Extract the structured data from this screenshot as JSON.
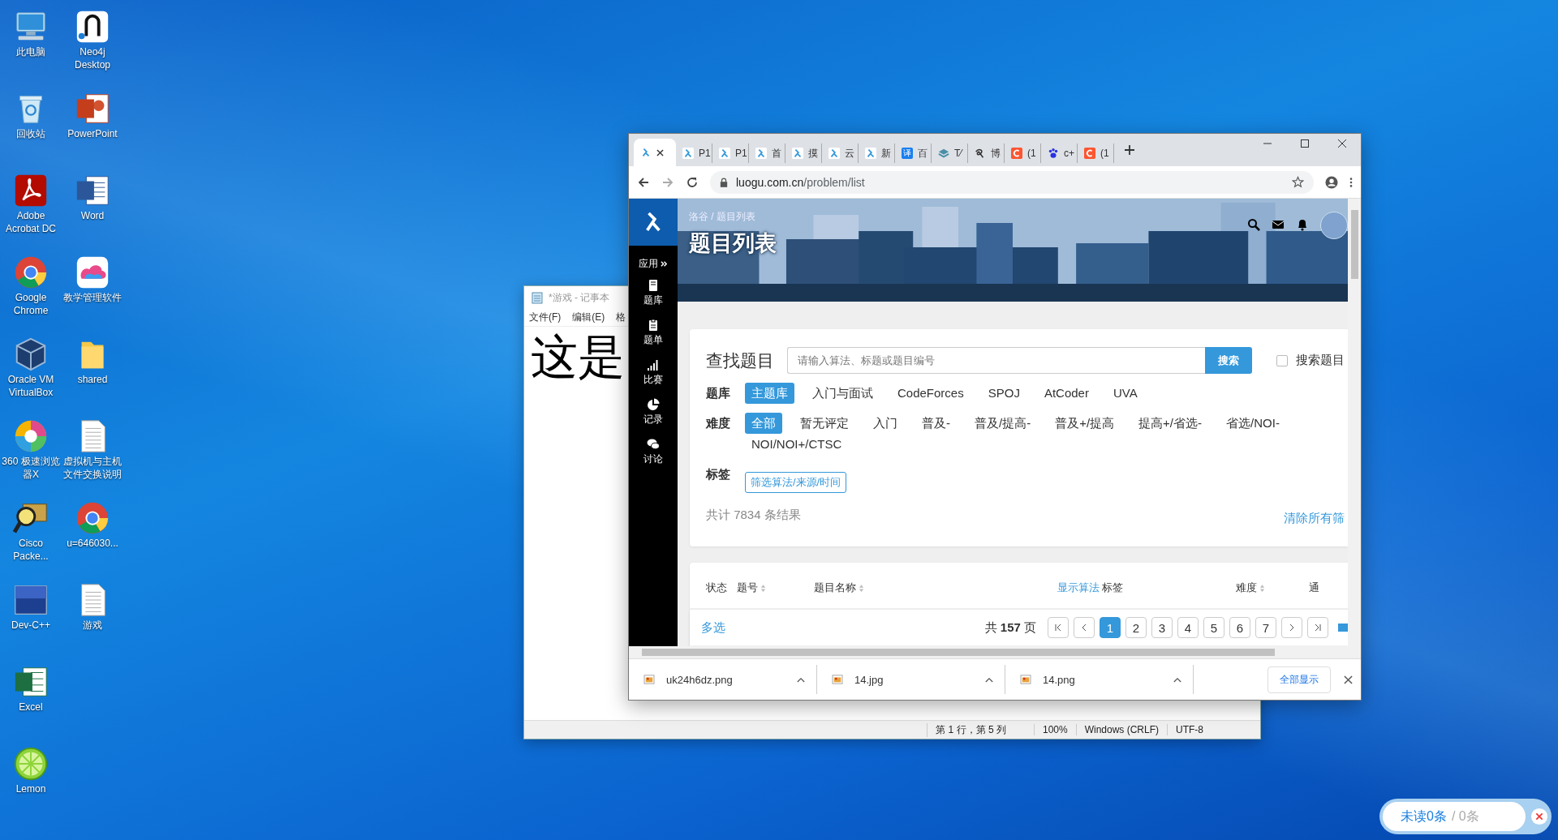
{
  "desktop_icons": [
    {
      "label": "此电脑",
      "kind": "monitor"
    },
    {
      "label": "回收站",
      "kind": "bin"
    },
    {
      "label": "Adobe Acrobat DC",
      "kind": "pdf"
    },
    {
      "label": "Google Chrome",
      "kind": "globe"
    },
    {
      "label": "Oracle VM VirtualBox",
      "kind": "cube"
    },
    {
      "label": "360 极速浏览器X",
      "kind": "swirl"
    },
    {
      "label": "Cisco Packe...",
      "kind": "magnifier"
    },
    {
      "label": "Dev-C++",
      "kind": "dev"
    },
    {
      "label": "Excel",
      "kind": "sheet"
    },
    {
      "label": "Lemon",
      "kind": "lime"
    },
    {
      "label": "Neo4j Desktop",
      "kind": "graph"
    },
    {
      "label": "PowerPoint",
      "kind": "slides"
    },
    {
      "label": "Word",
      "kind": "doc"
    },
    {
      "label": "教学管理软件",
      "kind": "cloud"
    },
    {
      "label": "shared",
      "kind": "folder"
    },
    {
      "label": "虚拟机与主机文件交换说明",
      "kind": "textfile"
    },
    {
      "label": "u=646030...",
      "kind": "globe"
    },
    {
      "label": "游戏",
      "kind": "textfile"
    }
  ],
  "notepad": {
    "title": "*游戏 - 记事本",
    "menu": [
      "文件(F)",
      "编辑(E)",
      "格"
    ],
    "text": "这是",
    "status": [
      "第 1 行，第 5 列",
      "100%",
      "Windows (CRLF)",
      "UTF-8"
    ]
  },
  "browser": {
    "tabs": [
      {
        "selected": true,
        "kind": "bird"
      },
      {
        "label": "P1",
        "selected": false,
        "kind": "bird"
      },
      {
        "label": "P1",
        "selected": false,
        "kind": "bird"
      },
      {
        "label": "首",
        "selected": false,
        "kind": "bird"
      },
      {
        "label": "摸",
        "selected": false,
        "kind": "bird"
      },
      {
        "label": "云",
        "selected": false,
        "kind": "bird"
      },
      {
        "label": "新",
        "selected": false,
        "kind": "bird"
      },
      {
        "label": "百",
        "selected": false,
        "kind": "badge"
      },
      {
        "label": "T⁄",
        "selected": false,
        "kind": "stack"
      },
      {
        "label": "博",
        "selected": false,
        "kind": "loop"
      },
      {
        "label": "(1",
        "selected": false,
        "kind": "square"
      },
      {
        "label": "c+",
        "selected": false,
        "kind": "paw"
      },
      {
        "label": "(1",
        "selected": false,
        "kind": "square"
      }
    ],
    "badge_char": "译",
    "address_host": "luogu.com.cn",
    "address_path": "/problem/list",
    "downloads": [
      "uk24h6dz.png",
      "14.jpg",
      "14.png"
    ],
    "show_all": "全部显示"
  },
  "site": {
    "apps": "应用",
    "nav": [
      {
        "label": "题库",
        "kind": "book"
      },
      {
        "label": "题单",
        "kind": "clipboard"
      },
      {
        "label": "比赛",
        "kind": "bars"
      },
      {
        "label": "记录",
        "kind": "pie"
      },
      {
        "label": "讨论",
        "kind": "chat"
      }
    ],
    "breadcrumb": "洛谷 / 题目列表",
    "page_title": "题目列表"
  },
  "search": {
    "heading": "查找题目",
    "placeholder": "请输入算法、标题或题目编号",
    "button": "搜索",
    "checkbox": {
      "label": "搜索题目",
      "checked": false
    }
  },
  "filters": [
    {
      "label": "题库",
      "kind": "chips",
      "options": [
        {
          "label": "主题库",
          "selected": true
        },
        {
          "label": "入门与面试",
          "selected": false
        },
        {
          "label": "CodeForces",
          "selected": false
        },
        {
          "label": "SPOJ",
          "selected": false
        },
        {
          "label": "AtCoder",
          "selected": false
        },
        {
          "label": "UVA",
          "selected": false
        }
      ]
    },
    {
      "label": "难度",
      "kind": "chips",
      "options": [
        {
          "label": "全部",
          "selected": true
        },
        {
          "label": "暂无评定",
          "selected": false
        },
        {
          "label": "入门",
          "selected": false
        },
        {
          "label": "普及-",
          "selected": false
        },
        {
          "label": "普及/提高-",
          "selected": false
        },
        {
          "label": "普及+/提高",
          "selected": false
        },
        {
          "label": "提高+/省选-",
          "selected": false
        },
        {
          "label": "省选/NOI-",
          "selected": false
        },
        {
          "label": "NOI/NOI+/CTSC",
          "selected": false
        }
      ]
    },
    {
      "label": "标签",
      "kind": "button",
      "button": "筛选算法/来源/时间"
    }
  ],
  "result_count": "共计 7834 条结果",
  "clear_filters": "清除所有筛",
  "table": {
    "columns": [
      {
        "label": "状态",
        "sortable": false
      },
      {
        "label": "题号",
        "sortable": true
      },
      {
        "label": "题目名称",
        "sortable": true
      },
      {
        "link": "显示算法",
        "label": "标签",
        "sortable": false
      },
      {
        "label": "难度",
        "sortable": true
      },
      {
        "label": "通",
        "sortable": false
      }
    ]
  },
  "pager": {
    "multi_select": "多选",
    "pages_text": "共 **157** 页",
    "pages": [
      {
        "label": "1",
        "selected": true
      },
      {
        "label": "2",
        "selected": false
      },
      {
        "label": "3",
        "selected": false
      },
      {
        "label": "4",
        "selected": false
      },
      {
        "label": "5",
        "selected": false
      },
      {
        "label": "6",
        "selected": false
      },
      {
        "label": "7",
        "selected": false
      }
    ]
  },
  "chat_widget": {
    "unread": "未读0条",
    "total": "/ 0条"
  }
}
